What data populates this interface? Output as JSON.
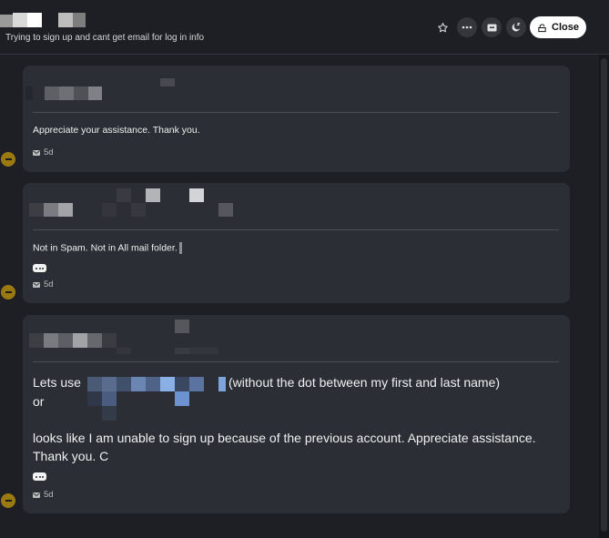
{
  "header": {
    "subtitle": "Trying to sign up and cant get email for log in info",
    "star_icon": "star-icon",
    "more_icon": "more-dots-icon",
    "archive_icon": "archive-icon",
    "snooze_icon": "snooze-icon",
    "close_label": "Close",
    "close_icon": "close-lock-icon"
  },
  "messages": [
    {
      "text": "Appreciate your assistance. Thank you.",
      "channel_icon": "mail-icon",
      "age": "5d",
      "badge_icon": "minus-icon"
    },
    {
      "text": "Not in Spam. Not in All mail folder.",
      "channel_icon": "mail-icon",
      "age": "5d",
      "badge_icon": "minus-icon",
      "has_more": true
    },
    {
      "line1_prefix": "Lets use",
      "line1_suffix": "(without the dot between my first and last name)",
      "line2": "or",
      "line3": "looks like I am unable to sign up because of the previous account. Appreciate assistance.",
      "line4": "Thank you. C",
      "channel_icon": "mail-icon",
      "age": "5d",
      "badge_icon": "minus-icon",
      "has_more": true
    }
  ]
}
